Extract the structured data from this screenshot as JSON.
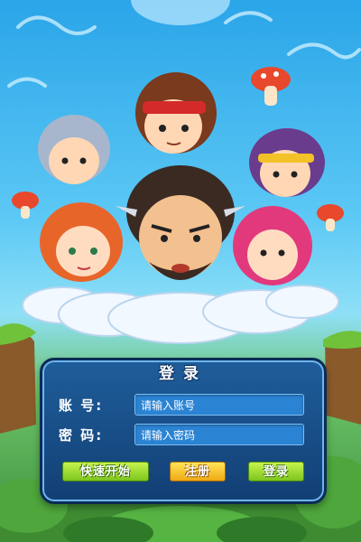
{
  "login": {
    "title": "登录",
    "account_label": "账  号:",
    "account_placeholder": "请输入账号",
    "password_label": "密  码:",
    "password_placeholder": "请输入密码",
    "quick_start_label": "快速开始",
    "register_label": "注册",
    "login_label": "登录"
  },
  "colors": {
    "panel": "#1a4f88",
    "input": "#2b83d3",
    "quick_start": "#9ad62a",
    "register": "#f5c21f",
    "login": "#9ad62a"
  }
}
